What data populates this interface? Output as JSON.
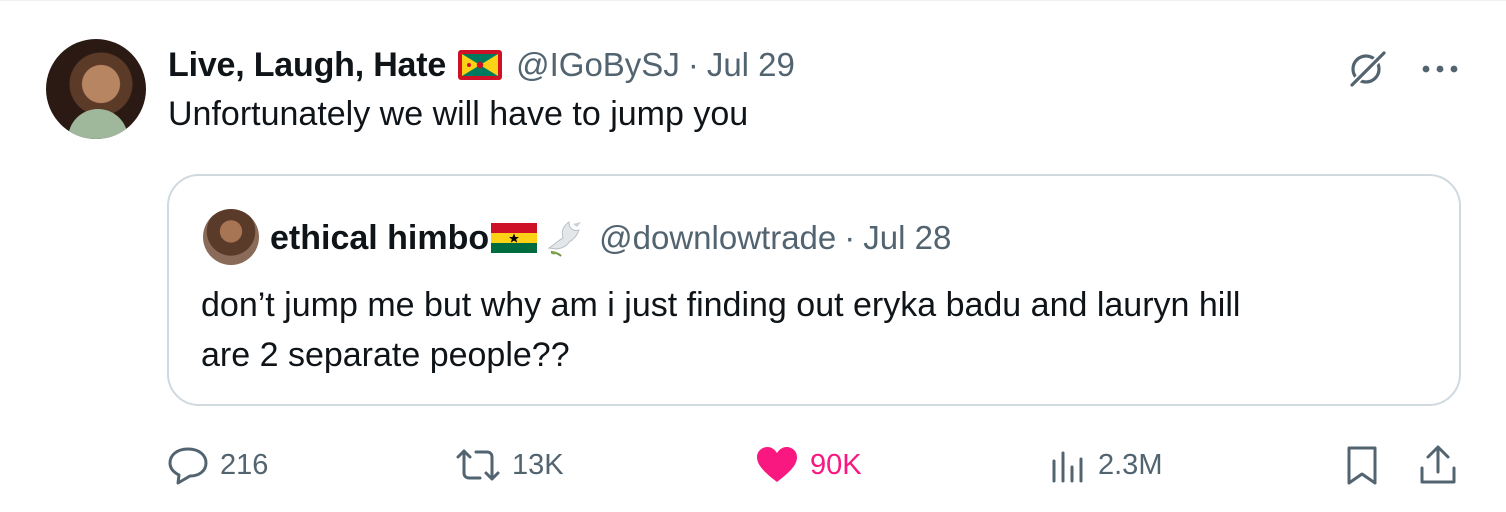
{
  "tweet": {
    "author_name": "Live, Laugh, Hate",
    "flag_icon": "grenada-flag-icon",
    "handle": "@IGoBySJ",
    "separator": "·",
    "date": "Jul 29",
    "text": "Unfortunately we will have to jump you"
  },
  "quoted": {
    "author_name": "ethical himbo",
    "flag_icon": "ghana-flag-icon",
    "emoji_icon": "dove-icon",
    "handle": "@downlowtrade",
    "separator": "·",
    "date": "Jul 28",
    "text_lines": [
      "don’t jump me but why am i just finding out eryka badu and lauryn hill",
      "are 2 separate people??"
    ]
  },
  "actions": {
    "replies": "216",
    "reposts": "13K",
    "likes": "90K",
    "views": "2.3M"
  },
  "colors": {
    "text": "#0f1419",
    "secondary": "#536471",
    "like": "#f91880",
    "border": "#cfd9de"
  }
}
